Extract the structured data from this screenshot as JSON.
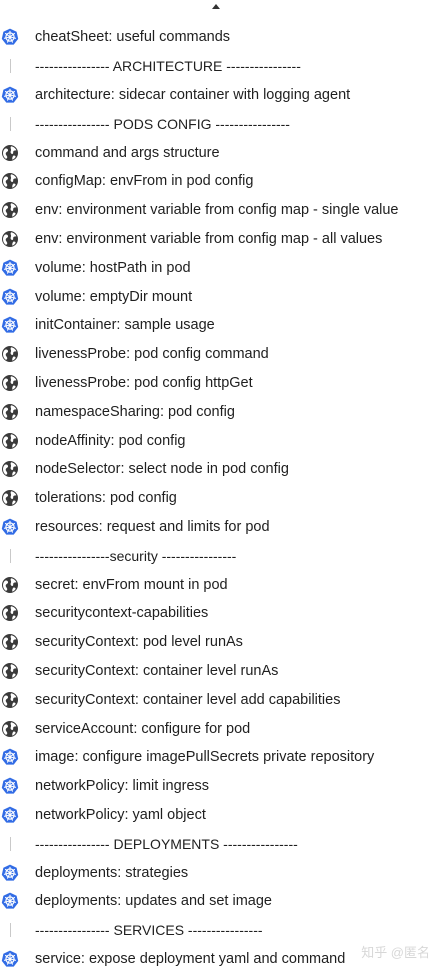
{
  "colors": {
    "k8s_blue": "#326CE5",
    "globe_gray": "#3a3a3a",
    "separator": "#c9c9c9"
  },
  "items": [
    {
      "icon": "kubernetes-icon",
      "text": "cheatSheet: useful commands"
    },
    {
      "icon": "separator",
      "text": "---------------- ARCHITECTURE ----------------"
    },
    {
      "icon": "kubernetes-icon",
      "text": "architecture: sidecar container with logging agent"
    },
    {
      "icon": "separator",
      "text": "---------------- PODS CONFIG ----------------"
    },
    {
      "icon": "globe-icon",
      "text": "command and args structure"
    },
    {
      "icon": "globe-icon",
      "text": "configMap: envFrom in pod config"
    },
    {
      "icon": "globe-icon",
      "text": "env: environment variable from config map - single value"
    },
    {
      "icon": "globe-icon",
      "text": "env: environment variable from config map - all values"
    },
    {
      "icon": "kubernetes-icon",
      "text": "volume: hostPath in pod"
    },
    {
      "icon": "kubernetes-icon",
      "text": "volume: emptyDir mount"
    },
    {
      "icon": "kubernetes-icon",
      "text": "initContainer: sample usage"
    },
    {
      "icon": "globe-icon",
      "text": "livenessProbe: pod config command"
    },
    {
      "icon": "globe-icon",
      "text": "livenessProbe: pod config httpGet"
    },
    {
      "icon": "globe-icon",
      "text": "namespaceSharing: pod config"
    },
    {
      "icon": "globe-icon",
      "text": "nodeAffinity: pod config"
    },
    {
      "icon": "globe-icon",
      "text": "nodeSelector: select node in pod config"
    },
    {
      "icon": "globe-icon",
      "text": "tolerations: pod config"
    },
    {
      "icon": "kubernetes-icon",
      "text": "resources: request and limits for pod"
    },
    {
      "icon": "separator",
      "text": "----------------security ----------------"
    },
    {
      "icon": "globe-icon",
      "text": "secret: envFrom mount in pod"
    },
    {
      "icon": "globe-icon",
      "text": "securitycontext-capabilities"
    },
    {
      "icon": "globe-icon",
      "text": "securityContext: pod level runAs"
    },
    {
      "icon": "globe-icon",
      "text": "securityContext: container level runAs"
    },
    {
      "icon": "globe-icon",
      "text": "securityContext: container level add capabilities"
    },
    {
      "icon": "globe-icon",
      "text": "serviceAccount: configure for pod"
    },
    {
      "icon": "kubernetes-icon",
      "text": "image: configure imagePullSecrets private repository"
    },
    {
      "icon": "kubernetes-icon",
      "text": "networkPolicy: limit ingress"
    },
    {
      "icon": "kubernetes-icon",
      "text": "networkPolicy: yaml object"
    },
    {
      "icon": "separator",
      "text": "---------------- DEPLOYMENTS ----------------"
    },
    {
      "icon": "kubernetes-icon",
      "text": "deployments: strategies"
    },
    {
      "icon": "kubernetes-icon",
      "text": "deployments: updates and set image"
    },
    {
      "icon": "separator",
      "text": "---------------- SERVICES ----------------"
    },
    {
      "icon": "kubernetes-icon",
      "text": "service: expose deployment yaml and command"
    }
  ],
  "watermark": "知乎 @匿名"
}
